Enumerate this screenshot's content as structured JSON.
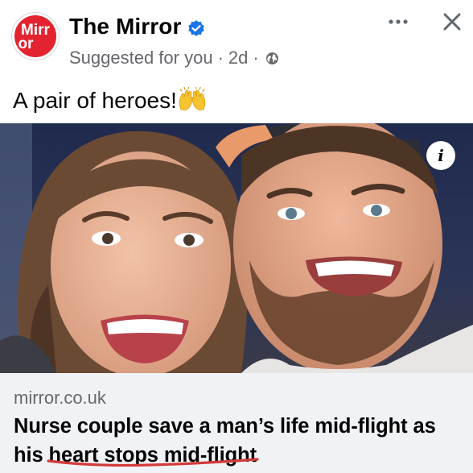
{
  "post": {
    "page_name": "The Mirror",
    "avatar_text_top": "Mirr",
    "avatar_text_bottom": "or",
    "verified_icon": "verified-badge-icon",
    "suggested": "Suggested for you",
    "separator": "·",
    "time": "2d",
    "audience_icon": "globe-icon",
    "more_icon": "more-options-icon",
    "close_icon": "close-icon",
    "text": "A pair of heroes!",
    "emoji_icon": "raising-hands-emoji"
  },
  "media": {
    "description_icon": "info-icon",
    "info_label": "i"
  },
  "link": {
    "domain": "mirror.co.uk",
    "headline": "Nurse couple save a man’s life mid-flight as his heart stops mid-flight"
  },
  "colors": {
    "brand_red": "#e3232f",
    "verified_blue": "#1b74e4",
    "secondary_text": "#65676b",
    "card_bg": "#f0f2f5",
    "annotation_underline": "#d23a3a"
  }
}
